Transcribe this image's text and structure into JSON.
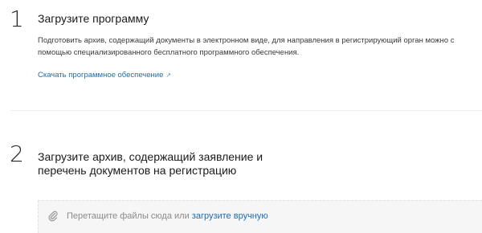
{
  "step1": {
    "number": "1",
    "title": "Загрузите программу",
    "description": "Подготовить архив, содержащий документы в электронном виде, для направления в регистрирующий орган можно с помощью специализированного бесплатного программного обеспечения.",
    "link_label": "Скачать программное обеспечение",
    "link_icon": "↗"
  },
  "step2": {
    "number": "2",
    "title": "Загрузите архив, содержащий заявление и перечень документов на регистрацию",
    "dropzone": {
      "icon": "paperclip-icon",
      "hint": "Перетащите файлы сюда или",
      "upload_link": "загрузите вручную"
    }
  },
  "colors": {
    "link": "#1a6db5",
    "dropzone_bg": "#f6f6f6",
    "hint_text": "#8a8a8a"
  }
}
